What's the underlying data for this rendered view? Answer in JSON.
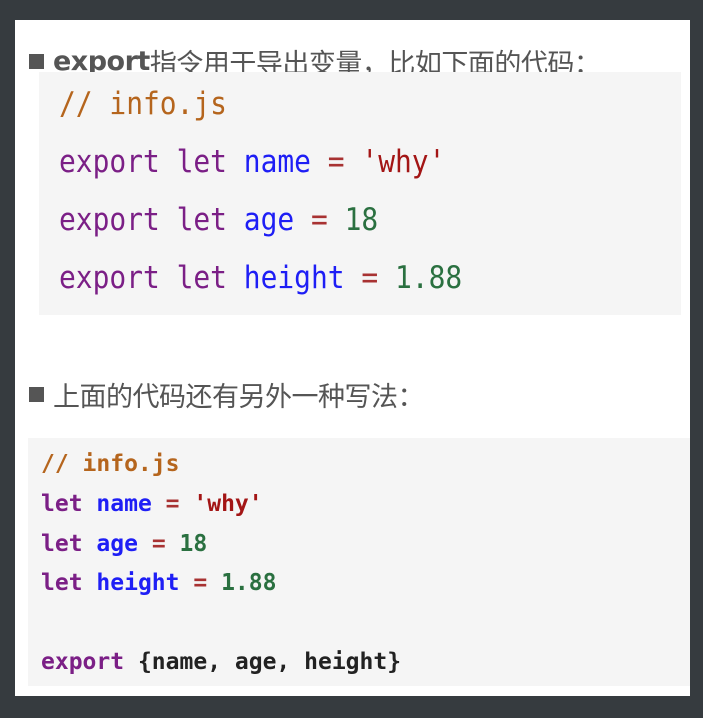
{
  "section1": {
    "heading_bold": "export",
    "heading_rest": "指令用于导出变量，比如下面的代码：",
    "code": {
      "comment": "// info.js",
      "lines": [
        {
          "kw1": "export",
          "kw2": "let",
          "name": "name",
          "op": "=",
          "value": "'why'",
          "value_type": "string"
        },
        {
          "kw1": "export",
          "kw2": "let",
          "name": "age",
          "op": "=",
          "value": "18",
          "value_type": "number"
        },
        {
          "kw1": "export",
          "kw2": "let",
          "name": "height",
          "op": "=",
          "value": "1.88",
          "value_type": "number"
        }
      ]
    }
  },
  "section2": {
    "heading": "上面的代码还有另外一种写法：",
    "code": {
      "comment": "// info.js",
      "lines": [
        {
          "kw": "let",
          "name": "name",
          "op": "=",
          "value": "'why'"
        },
        {
          "kw": "let",
          "name": "age",
          "op": "=",
          "value": "18"
        },
        {
          "kw": "let",
          "name": "height",
          "op": "=",
          "value": "1.88"
        }
      ],
      "export_kw": "export",
      "export_body": "{name, age, height}"
    }
  }
}
